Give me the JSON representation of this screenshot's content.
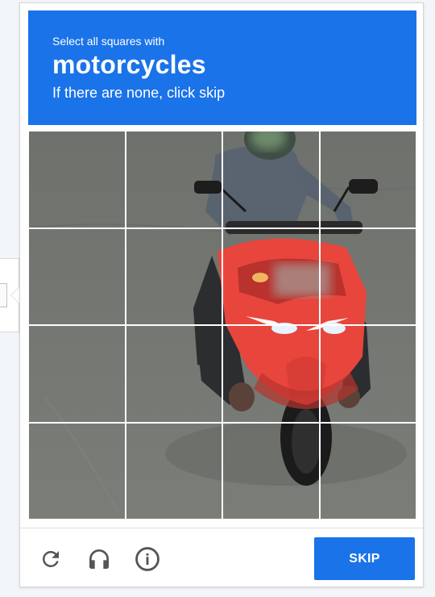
{
  "header": {
    "instruction": "Select all squares with",
    "target": "motorcycles",
    "hint": "If there are none, click skip"
  },
  "grid": {
    "rows": 4,
    "columns": 4
  },
  "footer": {
    "reload_icon": "reload-icon",
    "audio_icon": "headphones-icon",
    "info_icon": "info-icon",
    "skip_label": "SKIP"
  },
  "colors": {
    "accent": "#1a73e8",
    "road": "#747772",
    "motorcycle_fairing": "#e8453c"
  }
}
